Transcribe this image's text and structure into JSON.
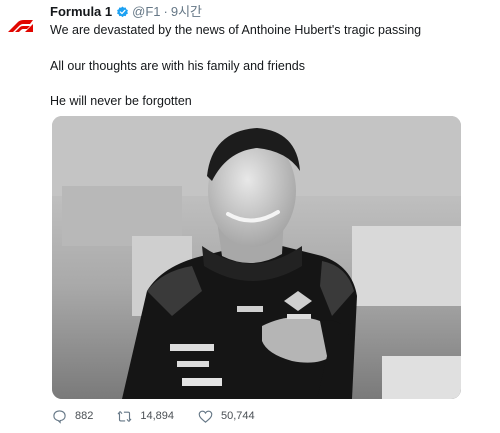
{
  "tweet": {
    "display_name": "Formula 1",
    "handle": "@F1",
    "separator": "·",
    "time": "9시간",
    "lines": [
      "We are devastated by the news of Anthoine Hubert's tragic passing",
      "All our thoughts are with his family and friends",
      "He will never be forgotten"
    ],
    "photo_description": "Black and white photo of driver in race suit with hand on chest"
  },
  "actions": {
    "reply_count": "882",
    "retweet_count": "14,894",
    "like_count": "50,744"
  },
  "icons": {
    "avatar": "formula1-logo-icon",
    "verified": "verified-badge-icon",
    "reply": "reply-icon",
    "retweet": "retweet-icon",
    "like": "heart-icon"
  },
  "colors": {
    "f1_red": "#e10600",
    "verified_blue": "#1da1f2",
    "meta_gray": "#657786"
  }
}
